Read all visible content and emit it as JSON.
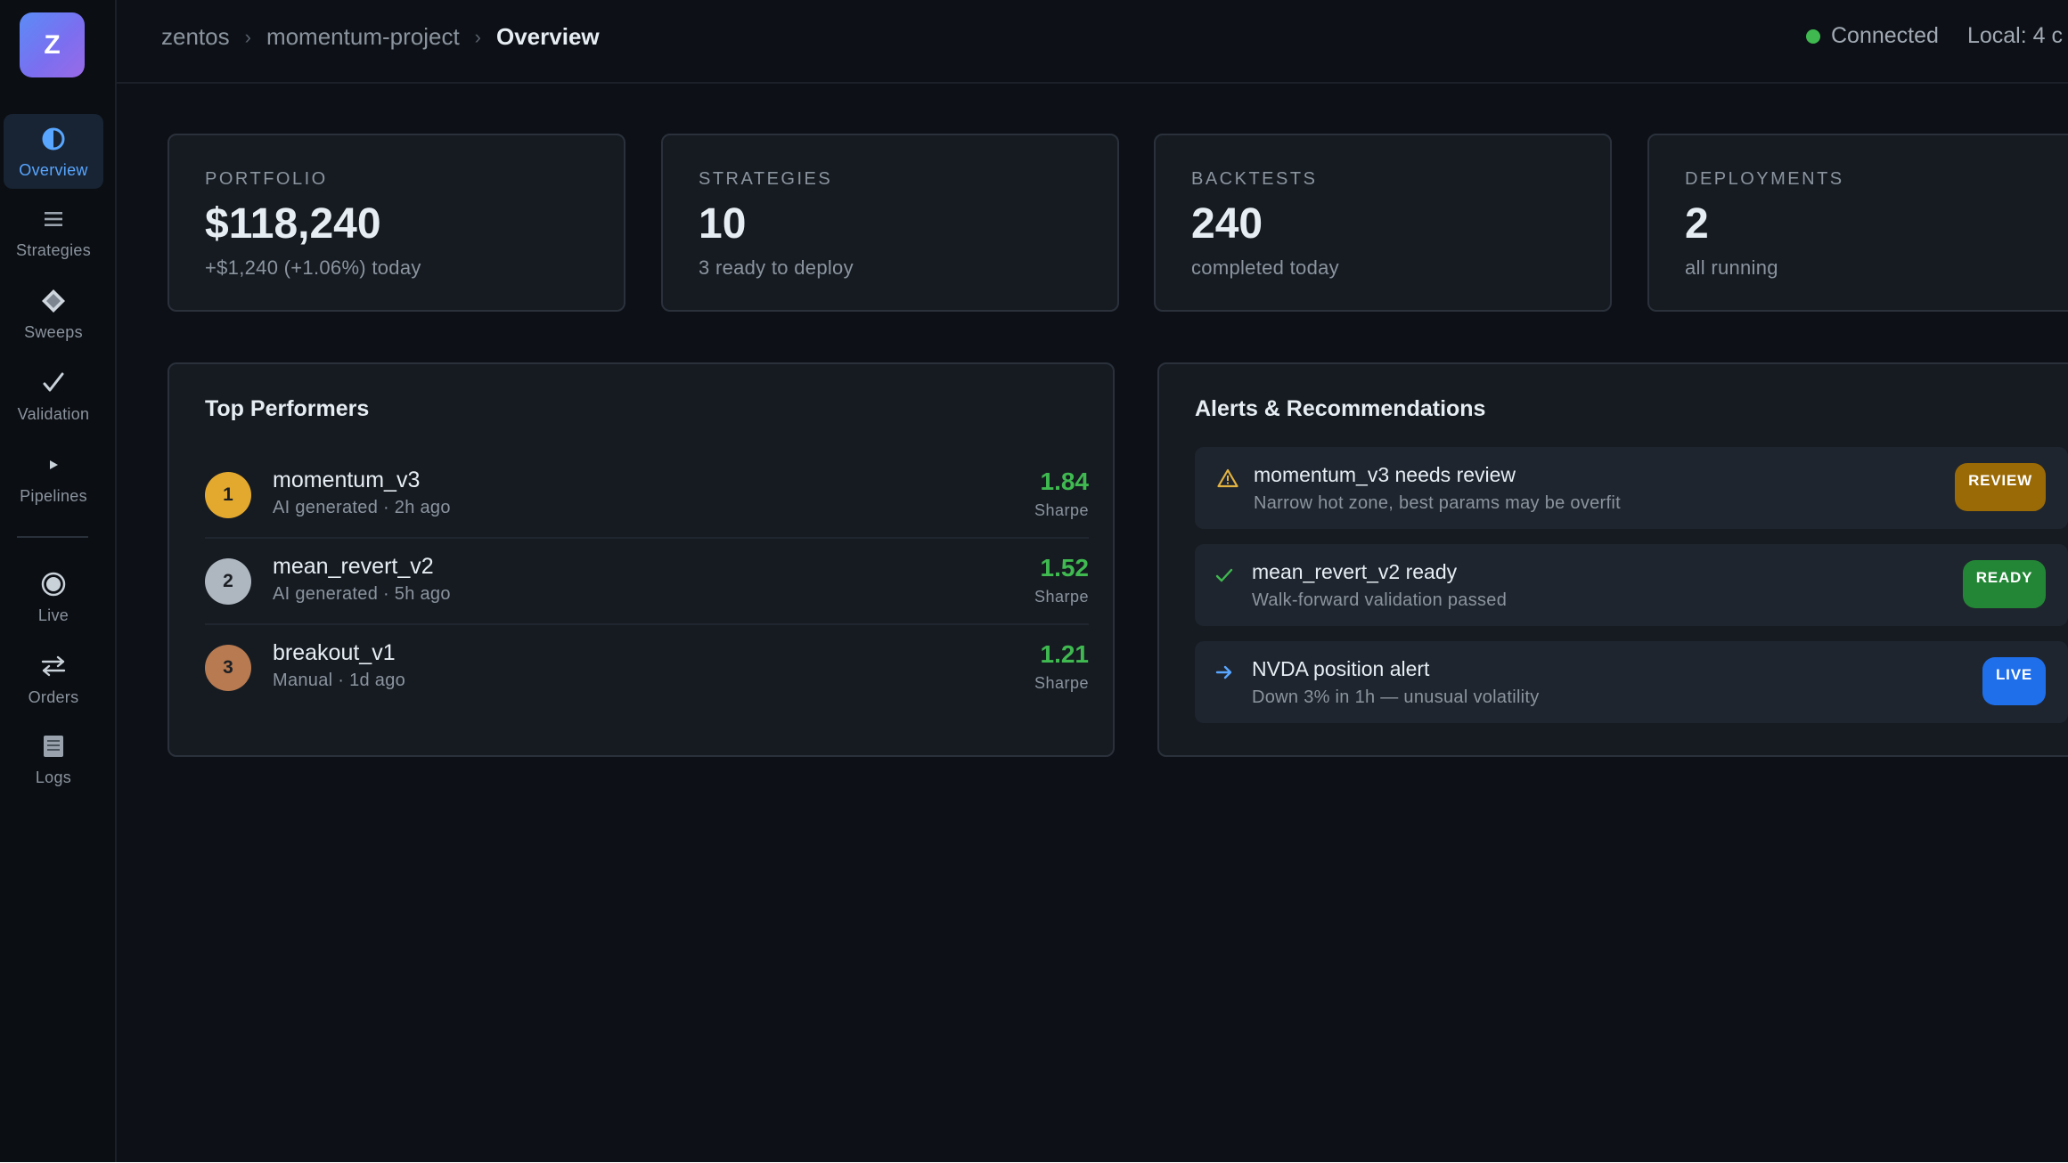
{
  "app": {
    "logo_letter": "Z",
    "brand_colors": {
      "logo_gradient_start": "#5b8cf6",
      "logo_gradient_end": "#9a6ae6"
    }
  },
  "sidebar": {
    "items": [
      {
        "label": "Overview",
        "icon": "half-circle-icon",
        "active": true
      },
      {
        "label": "Strategies",
        "icon": "list-icon",
        "active": false
      },
      {
        "label": "Sweeps",
        "icon": "diamond-icon",
        "active": false
      },
      {
        "label": "Validation",
        "icon": "check-icon",
        "active": false
      },
      {
        "label": "Pipelines",
        "icon": "play-icon",
        "active": false
      },
      {
        "label": "Live",
        "icon": "radio-icon",
        "active": false
      },
      {
        "label": "Orders",
        "icon": "swap-arrows-icon",
        "active": false
      },
      {
        "label": "Logs",
        "icon": "document-icon",
        "active": false
      }
    ]
  },
  "header": {
    "breadcrumb": [
      "zentos",
      "momentum-project",
      "Overview"
    ],
    "separator": "›",
    "status_text": "Connected",
    "status_color": "#3fb950",
    "local_text": "Local: 4 c"
  },
  "stats": [
    {
      "label": "PORTFOLIO",
      "value": "$118,240",
      "sub": "+$1,240 (+1.06%) today"
    },
    {
      "label": "STRATEGIES",
      "value": "10",
      "sub": "3 ready to deploy"
    },
    {
      "label": "BACKTESTS",
      "value": "240",
      "sub": "completed today"
    },
    {
      "label": "DEPLOYMENTS",
      "value": "2",
      "sub": "all running"
    }
  ],
  "top_performers": {
    "title": "Top Performers",
    "rows": [
      {
        "rank": "1",
        "name": "momentum_v3",
        "meta": "AI generated · 2h ago",
        "score": "1.84",
        "unit": "Sharpe",
        "rank_color": "#e3a92f"
      },
      {
        "rank": "2",
        "name": "mean_revert_v2",
        "meta": "AI generated · 5h ago",
        "score": "1.52",
        "unit": "Sharpe",
        "rank_color": "#aeb6bf"
      },
      {
        "rank": "3",
        "name": "breakout_v1",
        "meta": "Manual · 1d ago",
        "score": "1.21",
        "unit": "Sharpe",
        "rank_color": "#b87a50"
      }
    ]
  },
  "alerts": {
    "title": "Alerts & Recommendations",
    "items": [
      {
        "icon": "warning-icon",
        "title": "momentum_v3 needs review",
        "desc": "Narrow hot zone, best params may be overfit",
        "badge": "REVIEW",
        "badge_color": "#9a6a06"
      },
      {
        "icon": "check-icon",
        "title": "mean_revert_v2 ready",
        "desc": "Walk-forward validation passed",
        "badge": "READY",
        "badge_color": "#238636"
      },
      {
        "icon": "arrow-right-icon",
        "title": "NVDA position alert",
        "desc": "Down 3% in 1h — unusual volatility",
        "badge": "LIVE",
        "badge_color": "#1f6feb"
      }
    ]
  }
}
